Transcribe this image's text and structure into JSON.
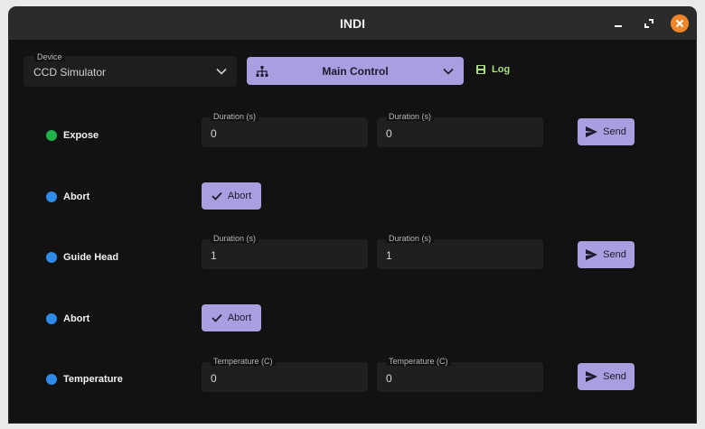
{
  "window": {
    "title": "INDI"
  },
  "device": {
    "label": "Device",
    "value": "CCD Simulator"
  },
  "main_control": {
    "label": "Main Control"
  },
  "log": {
    "label": "Log"
  },
  "rows": [
    {
      "label": "Expose",
      "status_color": "#22b24c",
      "fields": [
        {
          "label": "Duration (s)",
          "value": "0"
        },
        {
          "label": "Duration (s)",
          "value": "0"
        }
      ],
      "button": "Send"
    },
    {
      "label": "Abort",
      "status_color": "#2e8be8",
      "button": "Abort"
    },
    {
      "label": "Guide Head",
      "status_color": "#2e8be8",
      "fields": [
        {
          "label": "Duration (s)",
          "value": "1"
        },
        {
          "label": "Duration (s)",
          "value": "1"
        }
      ],
      "button": "Send"
    },
    {
      "label": "Abort",
      "status_color": "#2e8be8",
      "button": "Abort"
    },
    {
      "label": "Temperature",
      "status_color": "#2e8be8",
      "fields": [
        {
          "label": "Temperature (C)",
          "value": "0"
        },
        {
          "label": "Temperature (C)",
          "value": "0"
        }
      ],
      "button": "Send"
    }
  ],
  "colors": {
    "accent": "#a89ee0",
    "close": "#f0862a",
    "log": "#a7e07a"
  },
  "icons": {
    "minimize": "minimize-icon",
    "maximize": "maximize-icon",
    "close": "close-icon",
    "hierarchy": "sitemap-icon",
    "log": "save-icon",
    "send": "send-icon",
    "check": "check-icon"
  }
}
